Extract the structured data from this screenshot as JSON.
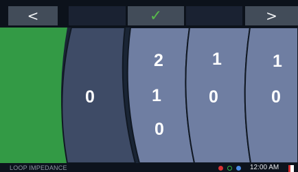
{
  "toolbar": {
    "prev_label": "<",
    "confirm_label": "✓",
    "next_label": ">"
  },
  "wheels": [
    {
      "above": "",
      "selected": "0",
      "below": ""
    },
    {
      "above": "2",
      "selected": "1",
      "below": "0"
    },
    {
      "above": "1",
      "selected": "0",
      "below": ""
    },
    {
      "above": "1",
      "selected": "0",
      "below": ""
    }
  ],
  "footer": {
    "label": "LOOP IMPEDANCE",
    "time": "12:00 AM"
  },
  "colors": {
    "green_panel": "#339a45",
    "selected_wheel": "#3e4b66",
    "wheel": "#6f7ea2",
    "check": "#57b84b",
    "status_red": "#d63233",
    "status_green": "#35b54a",
    "status_blue": "#4b8ce6"
  },
  "icons": [
    "chevron-left-icon",
    "checkmark-icon",
    "chevron-right-icon",
    "status-dot-icons",
    "flag-icon"
  ]
}
